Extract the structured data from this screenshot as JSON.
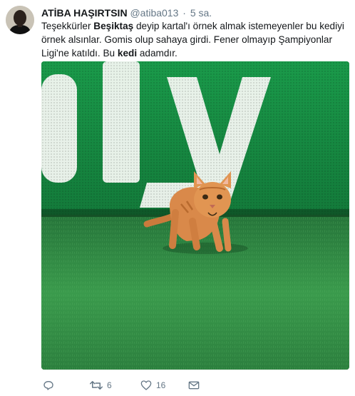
{
  "tweet": {
    "author_name": "ATİBA HAŞIRTSIN",
    "author_handle": "@atiba013",
    "separator": "·",
    "timestamp": "5 sa.",
    "text_parts": [
      "Teşekkürler ",
      "Beşiktaş",
      " deyip kartal'ı örnek almak istemeyenler bu kediyi örnek alsınlar. Gomis olup sahaya girdi. Fener olmayıp Şampiyonlar Ligi'ne katıldı. Bu ",
      "kedi",
      " adamdır."
    ]
  },
  "actions": {
    "reply_icon": "reply-icon",
    "retweet_icon": "retweet-icon",
    "retweet_count": "6",
    "like_icon": "heart-icon",
    "like_count": "16",
    "dm_icon": "envelope-icon"
  },
  "colors": {
    "text": "#14171a",
    "muted": "#657786",
    "pitch": "#2f8a44",
    "board": "#1e8f45",
    "cat": "#d9894a"
  }
}
